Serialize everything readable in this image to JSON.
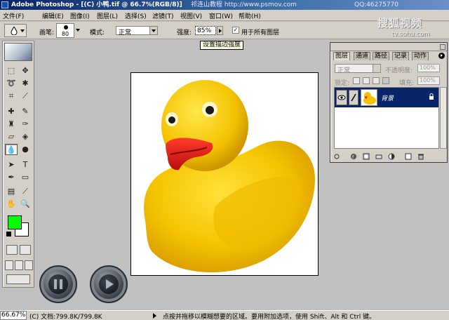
{
  "window": {
    "title": "Adobe Photoshop - [(C) 小鸭.tif @ 66.7%(RGB/8)]",
    "watermark_tutorial": "祁连山教程 http://www.psmov.com",
    "watermark_qq": "QQ:46275770"
  },
  "sohu_watermark": {
    "logo": "搜狐视频",
    "url": "tv.sohu.com"
  },
  "menu": {
    "items": [
      "文件(F)",
      "编辑(E)",
      "图像(I)",
      "图层(L)",
      "选择(S)",
      "滤镜(T)",
      "视图(V)",
      "窗口(W)",
      "帮助(H)"
    ]
  },
  "options": {
    "brush_label": "画笔:",
    "brush_size": "80",
    "mode_label": "模式:",
    "mode_value": "正常",
    "strength_label": "强度:",
    "strength_value": "85%",
    "all_layers_label": "用于所有图层",
    "all_layers_checked": "✓",
    "tooltip": "设置描边强度"
  },
  "toolbox": {
    "tool_icons": [
      "marquee-icon",
      "move-icon",
      "lasso-icon",
      "magic-wand-icon",
      "crop-icon",
      "slice-icon",
      "healing-brush-icon",
      "brush-icon",
      "clone-stamp-icon",
      "history-brush-icon",
      "eraser-icon",
      "paint-bucket-icon",
      "blur-icon",
      "dodge-icon",
      "path-selection-icon",
      "type-icon",
      "pen-icon",
      "shape-icon",
      "notes-icon",
      "eyedropper-icon",
      "hand-icon",
      "zoom-icon"
    ],
    "foreground_color": "#00ff00",
    "background_color": "#ffffff"
  },
  "layers_panel": {
    "tabs": [
      "图层",
      "通道",
      "路径",
      "记录",
      "动作"
    ],
    "blend_mode": "正常",
    "opacity_label": "不透明度:",
    "opacity_value": "100%",
    "lock_label": "锁定:",
    "fill_label": "填充:",
    "fill_value": "100%",
    "layers": [
      {
        "name": "背景",
        "selected": true
      }
    ]
  },
  "status": {
    "zoom": "66.67%",
    "doc_info": "(C) 文档:799.8K/799.8K",
    "hint": "点按并拖移以模糊想要的区域。要用附加选项，使用 Shift、Alt 和 Ctrl 键。"
  }
}
